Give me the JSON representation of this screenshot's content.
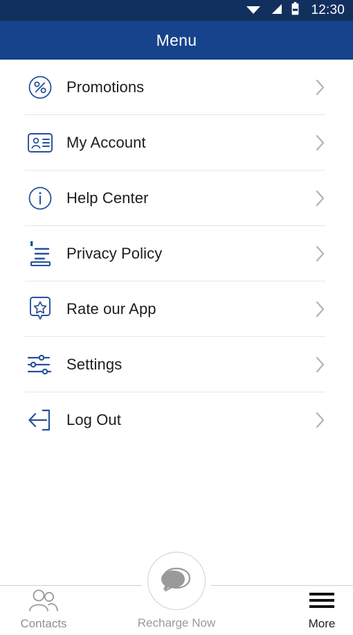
{
  "status_bar": {
    "time": "12:30",
    "icons": [
      "wifi-icon",
      "cellular-signal-icon",
      "battery-icon"
    ],
    "background_color": "#12305e"
  },
  "header": {
    "title": "Menu",
    "background_color": "#16438c",
    "text_color": "#ffffff"
  },
  "menu": {
    "icon_color": "#27509b",
    "label_color": "#1d1d1d",
    "chevron_color": "#b3b3b3",
    "divider_color": "#e6e6e6",
    "items": [
      {
        "label": "Promotions",
        "icon": "percent-circle-icon",
        "has_divider": true
      },
      {
        "label": "My Account",
        "icon": "id-card-icon",
        "has_divider": true
      },
      {
        "label": "Help Center",
        "icon": "info-circle-icon",
        "has_divider": true
      },
      {
        "label": "Privacy Policy",
        "icon": "document-lines-icon",
        "has_divider": true
      },
      {
        "label": "Rate our App",
        "icon": "star-bubble-icon",
        "has_divider": true
      },
      {
        "label": "Settings",
        "icon": "sliders-icon",
        "has_divider": true
      },
      {
        "label": "Log Out",
        "icon": "logout-arrow-icon",
        "has_divider": false
      }
    ]
  },
  "bottom_bar": {
    "contacts": {
      "label": "Contacts",
      "icon": "people-icon",
      "active": false
    },
    "recharge": {
      "label": "Recharge Now",
      "icon": "chat-bubbles-icon",
      "active": false
    },
    "more": {
      "label": "More",
      "icon": "hamburger-icon",
      "active": true
    }
  }
}
